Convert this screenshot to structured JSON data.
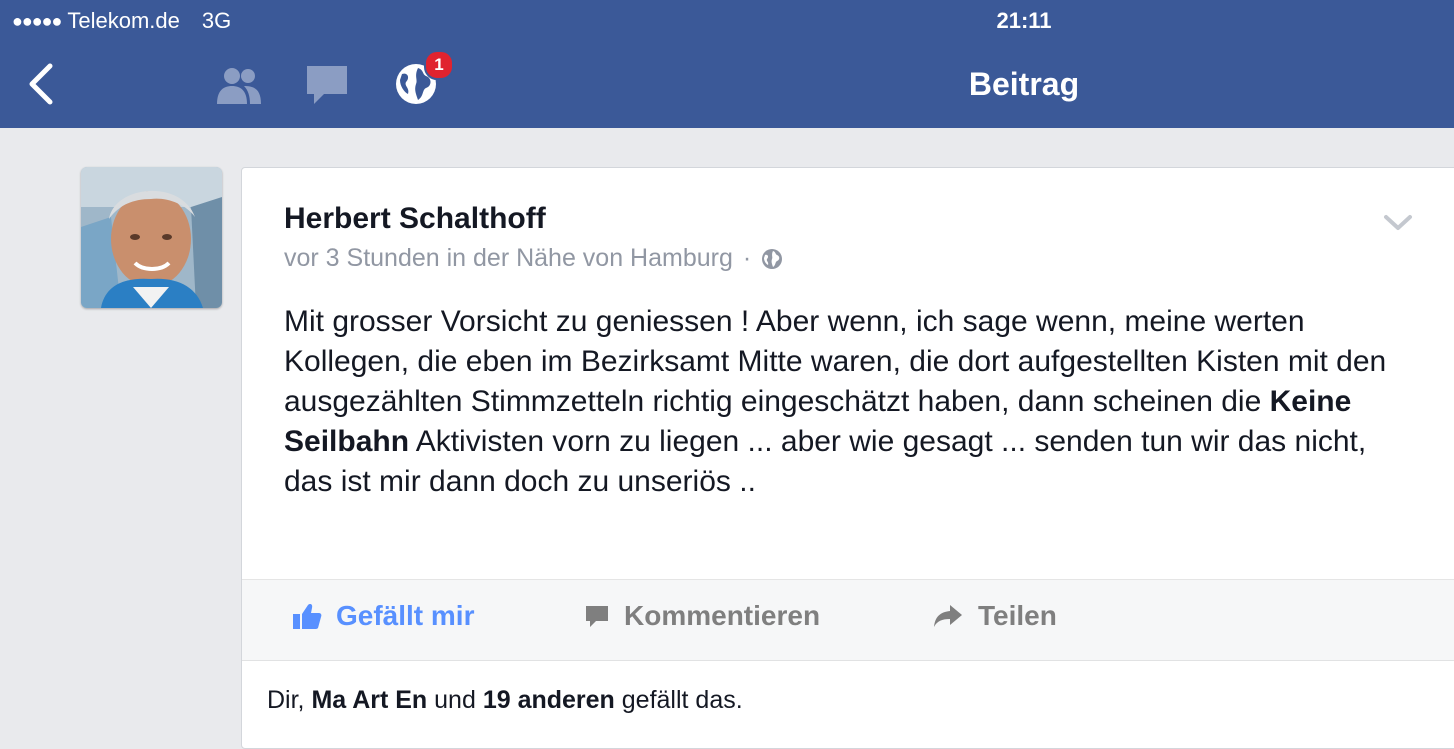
{
  "status_bar": {
    "signal_dots": "●●●●●",
    "carrier": "Telekom.de",
    "network": "3G",
    "time": "21:11"
  },
  "nav": {
    "back_icon": "chevron-left-icon",
    "friends_icon": "friends-icon",
    "messages_icon": "chat-bubble-icon",
    "notifications_icon": "globe-icon",
    "notification_count": "1",
    "title": "Beitrag"
  },
  "post": {
    "author": "Herbert Schalthoff",
    "meta": "vor 3 Stunden in der Nähe von Hamburg",
    "meta_separator": "·",
    "privacy_icon": "globe-icon",
    "text_before": "Mit grosser Vorsicht zu geniessen ! Aber wenn, ich sage wenn, meine werten Kollegen, die eben im Bezirksamt Mitte waren, die dort aufgestellten Kisten mit den ausgezählten Stimmzetteln richtig eingeschätzt haben, dann scheinen die ",
    "text_bold": "Keine Seilbahn",
    "text_after": " Aktivisten vorn zu liegen ... aber wie gesagt ... senden tun wir das nicht, das ist mir dann doch zu unseriös ..",
    "actions": {
      "like": "Gefällt mir",
      "comment": "Kommentieren",
      "share": "Teilen"
    },
    "likes": {
      "prefix": "Dir, ",
      "name": "Ma Art En",
      "middle": " und ",
      "others": "19 anderen",
      "suffix": " gefällt das."
    }
  },
  "colors": {
    "brand": "#3b5998",
    "like_blue": "#5890ff",
    "badge_red": "#e0232f",
    "background": "#e9eaed"
  }
}
